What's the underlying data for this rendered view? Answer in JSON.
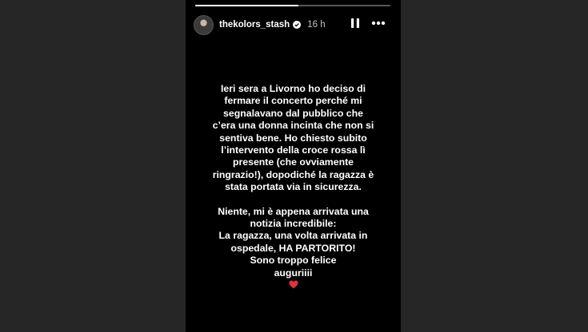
{
  "story": {
    "progress": 0.53,
    "username": "thekolors_stash",
    "time_ago": "16 h",
    "icons": {
      "verified": "verified-badge-icon",
      "pause": "pause-icon",
      "more": "more-icon",
      "heart": "red-heart-emoji"
    },
    "colors": {
      "heart": "#e0303c",
      "background": "#000000"
    }
  },
  "message": {
    "paragraph1": [
      "Ieri sera a Livorno ho deciso di",
      "fermare il concerto perché mi",
      "segnalavano dal pubblico che",
      "c’era una donna incinta che non si",
      "sentiva bene. Ho chiesto subito",
      "l’intervento della croce rossa lì",
      "presente (che ovviamente",
      "ringrazio!), dopodiché la ragazza è",
      "stata portata via in sicurezza."
    ],
    "paragraph2": [
      "Niente, mi è appena arrivata una",
      "notizia incredibile:",
      "La ragazza, una volta arrivata in",
      "ospedale, HA PARTORITO!",
      "Sono troppo felice",
      "auguriiii"
    ]
  }
}
